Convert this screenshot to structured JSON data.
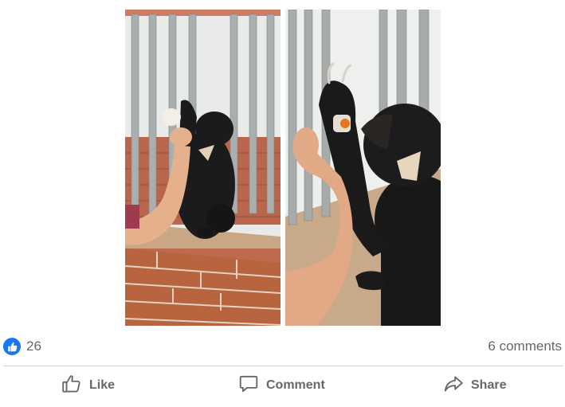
{
  "post": {
    "photos": [
      {
        "icon": "bear-cub-feeding-photo"
      },
      {
        "icon": "bear-paw-feeding-photo"
      }
    ],
    "reactions": {
      "icon": "like-icon",
      "count": "26"
    },
    "comments": {
      "count_label": "6 comments"
    },
    "actions": {
      "like_label": "Like",
      "comment_label": "Comment",
      "share_label": "Share"
    }
  },
  "colors": {
    "brand_blue": "#1877f2",
    "secondary_text": "#65676b",
    "divider": "#ced0d4"
  }
}
